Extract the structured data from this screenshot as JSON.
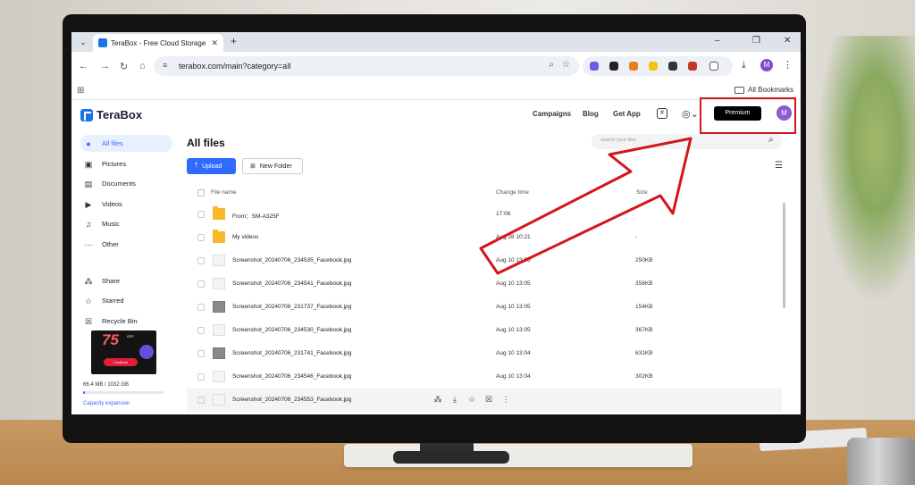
{
  "browser": {
    "tab_title": "TeraBox - Free Cloud Storage U",
    "url": "terabox.com/main?category=all",
    "bookmarks_label": "All Bookmarks",
    "profile_initial": "M"
  },
  "app": {
    "logo": "TeraBox",
    "nav": [
      "Campaigns",
      "Blog",
      "Get App"
    ],
    "premium_label": "Premium",
    "avatar_initial": "M",
    "accent_color": "#2f6bff",
    "highlight_color": "#d3161c"
  },
  "sidebar": {
    "items": [
      {
        "label": "All files",
        "icon": "all-files-icon"
      },
      {
        "label": "Pictures",
        "icon": "pictures-icon"
      },
      {
        "label": "Documents",
        "icon": "documents-icon"
      },
      {
        "label": "Videos",
        "icon": "videos-icon"
      },
      {
        "label": "Music",
        "icon": "music-icon"
      },
      {
        "label": "Other",
        "icon": "other-icon"
      },
      {
        "label": "Share",
        "icon": "share-icon"
      },
      {
        "label": "Starred",
        "icon": "star-icon"
      },
      {
        "label": "Recycle Bin",
        "icon": "trash-icon"
      }
    ],
    "promo": {
      "big": "75",
      "small": "OFF",
      "button": "Continue"
    },
    "storage_text": "66.4 MB / 1032 GB",
    "storage_fraction": 6e-05,
    "capacity_link": "Capacity expansion"
  },
  "main": {
    "title": "All files",
    "search_placeholder": "search your files",
    "upload_label": "Upload",
    "new_folder_label": "New Folder",
    "columns": {
      "name": "File name",
      "time": "Change time",
      "size": "Size"
    },
    "rows": [
      {
        "name": "From：SM-A325F",
        "time": "17:06",
        "size": "",
        "type": "folder"
      },
      {
        "name": "My videos",
        "time": "Aug 28 10:21",
        "size": "-",
        "type": "folder"
      },
      {
        "name": "Screenshot_20240706_234535_Facebook.jpg",
        "time": "Aug 10 13:06",
        "size": "250KB",
        "type": "img"
      },
      {
        "name": "Screenshot_20240706_234541_Facebook.jpg",
        "time": "Aug 10 13:05",
        "size": "358KB",
        "type": "img"
      },
      {
        "name": "Screenshot_20240706_231737_Facebook.jpg",
        "time": "Aug 10 13:05",
        "size": "154KB",
        "type": "img-dark"
      },
      {
        "name": "Screenshot_20240706_234530_Facebook.jpg",
        "time": "Aug 10 13:05",
        "size": "367KB",
        "type": "img"
      },
      {
        "name": "Screenshot_20240706_231741_Facebook.jpg",
        "time": "Aug 10 13:04",
        "size": "631KB",
        "type": "img-dark"
      },
      {
        "name": "Screenshot_20240706_234546_Facebook.jpg",
        "time": "Aug 10 13:04",
        "size": "302KB",
        "type": "img"
      },
      {
        "name": "Screenshot_20240706_234553_Facebook.jpg",
        "time": "",
        "size": "",
        "type": "img"
      }
    ]
  }
}
